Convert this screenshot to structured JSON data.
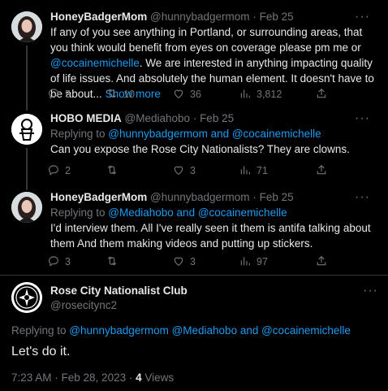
{
  "tweets": [
    {
      "name": "HoneyBadgerMom",
      "handle": "@hunnybadgermom",
      "sep": "·",
      "date": "Feb 25",
      "text_1": "If any of you see anything in Portland, or surrounding areas, that you think would benefit from eyes on coverage please pm me or ",
      "mention": "@cocainemichelle",
      "text_2": ". We are interested in anything impacting quality of life issues. And absolutely the human element. It doesn't have to be about...",
      "show_more": "Show more",
      "replies": "5",
      "retweets": "10",
      "likes": "36",
      "views": "3,812"
    },
    {
      "name": "HOBO MEDIA",
      "handle": "@Mediahobo",
      "sep": "·",
      "date": "Feb 25",
      "replying_prefix": "Replying to ",
      "replying_to": "@hunnybadgermom and @cocainemichelle",
      "text": "Can you expose the Rose City Nationalists? They are clowns.",
      "replies": "2",
      "retweets": "",
      "likes": "3",
      "views": "71"
    },
    {
      "name": "HoneyBadgerMom",
      "handle": "@hunnybadgermom",
      "sep": "·",
      "date": "Feb 25",
      "replying_prefix": "Replying to ",
      "replying_to": "@Mediahobo and @cocainemichelle",
      "text": "I'd interview them. All I've really seen it them is antifa talking about them And them making videos and putting up stickers.",
      "replies": "3",
      "retweets": "",
      "likes": "3",
      "views": "97"
    }
  ],
  "main": {
    "name": "Rose City Nationalist Club",
    "handle": "@rosecitync2",
    "replying_prefix": "Replying to ",
    "replying_to": "@hunnybadgermom @Mediahobo and @cocainemichelle",
    "text": "Let's do it.",
    "timestamp": "7:23 AM · Feb 28, 2023 · ",
    "views_count": "4",
    "views_label": " Views"
  },
  "more_icon": "···",
  "colors": {
    "accent": "#1d9bf0",
    "muted": "#71767b",
    "text": "#e7e9ea",
    "background": "#000000"
  },
  "icons": [
    "more-icon",
    "reply-icon",
    "retweet-icon",
    "like-icon",
    "views-icon",
    "share-icon"
  ]
}
